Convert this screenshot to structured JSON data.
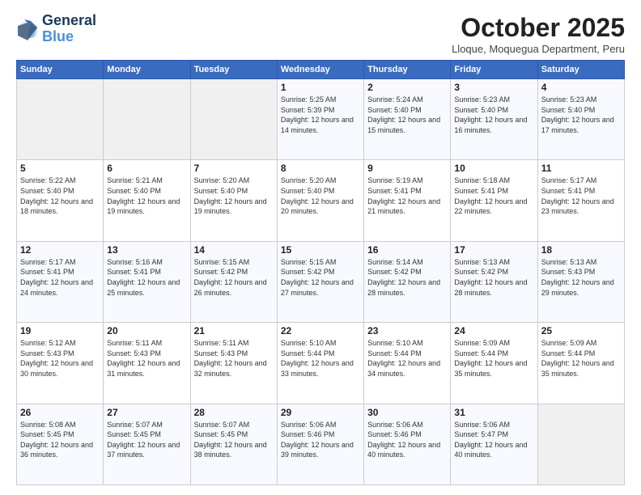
{
  "header": {
    "logo_line1": "General",
    "logo_line2": "Blue",
    "month_title": "October 2025",
    "location": "Lloque, Moquegua Department, Peru"
  },
  "weekdays": [
    "Sunday",
    "Monday",
    "Tuesday",
    "Wednesday",
    "Thursday",
    "Friday",
    "Saturday"
  ],
  "weeks": [
    [
      {
        "day": "",
        "sunrise": "",
        "sunset": "",
        "daylight": ""
      },
      {
        "day": "",
        "sunrise": "",
        "sunset": "",
        "daylight": ""
      },
      {
        "day": "",
        "sunrise": "",
        "sunset": "",
        "daylight": ""
      },
      {
        "day": "1",
        "sunrise": "Sunrise: 5:25 AM",
        "sunset": "Sunset: 5:39 PM",
        "daylight": "Daylight: 12 hours and 14 minutes."
      },
      {
        "day": "2",
        "sunrise": "Sunrise: 5:24 AM",
        "sunset": "Sunset: 5:40 PM",
        "daylight": "Daylight: 12 hours and 15 minutes."
      },
      {
        "day": "3",
        "sunrise": "Sunrise: 5:23 AM",
        "sunset": "Sunset: 5:40 PM",
        "daylight": "Daylight: 12 hours and 16 minutes."
      },
      {
        "day": "4",
        "sunrise": "Sunrise: 5:23 AM",
        "sunset": "Sunset: 5:40 PM",
        "daylight": "Daylight: 12 hours and 17 minutes."
      }
    ],
    [
      {
        "day": "5",
        "sunrise": "Sunrise: 5:22 AM",
        "sunset": "Sunset: 5:40 PM",
        "daylight": "Daylight: 12 hours and 18 minutes."
      },
      {
        "day": "6",
        "sunrise": "Sunrise: 5:21 AM",
        "sunset": "Sunset: 5:40 PM",
        "daylight": "Daylight: 12 hours and 19 minutes."
      },
      {
        "day": "7",
        "sunrise": "Sunrise: 5:20 AM",
        "sunset": "Sunset: 5:40 PM",
        "daylight": "Daylight: 12 hours and 19 minutes."
      },
      {
        "day": "8",
        "sunrise": "Sunrise: 5:20 AM",
        "sunset": "Sunset: 5:40 PM",
        "daylight": "Daylight: 12 hours and 20 minutes."
      },
      {
        "day": "9",
        "sunrise": "Sunrise: 5:19 AM",
        "sunset": "Sunset: 5:41 PM",
        "daylight": "Daylight: 12 hours and 21 minutes."
      },
      {
        "day": "10",
        "sunrise": "Sunrise: 5:18 AM",
        "sunset": "Sunset: 5:41 PM",
        "daylight": "Daylight: 12 hours and 22 minutes."
      },
      {
        "day": "11",
        "sunrise": "Sunrise: 5:17 AM",
        "sunset": "Sunset: 5:41 PM",
        "daylight": "Daylight: 12 hours and 23 minutes."
      }
    ],
    [
      {
        "day": "12",
        "sunrise": "Sunrise: 5:17 AM",
        "sunset": "Sunset: 5:41 PM",
        "daylight": "Daylight: 12 hours and 24 minutes."
      },
      {
        "day": "13",
        "sunrise": "Sunrise: 5:16 AM",
        "sunset": "Sunset: 5:41 PM",
        "daylight": "Daylight: 12 hours and 25 minutes."
      },
      {
        "day": "14",
        "sunrise": "Sunrise: 5:15 AM",
        "sunset": "Sunset: 5:42 PM",
        "daylight": "Daylight: 12 hours and 26 minutes."
      },
      {
        "day": "15",
        "sunrise": "Sunrise: 5:15 AM",
        "sunset": "Sunset: 5:42 PM",
        "daylight": "Daylight: 12 hours and 27 minutes."
      },
      {
        "day": "16",
        "sunrise": "Sunrise: 5:14 AM",
        "sunset": "Sunset: 5:42 PM",
        "daylight": "Daylight: 12 hours and 28 minutes."
      },
      {
        "day": "17",
        "sunrise": "Sunrise: 5:13 AM",
        "sunset": "Sunset: 5:42 PM",
        "daylight": "Daylight: 12 hours and 28 minutes."
      },
      {
        "day": "18",
        "sunrise": "Sunrise: 5:13 AM",
        "sunset": "Sunset: 5:43 PM",
        "daylight": "Daylight: 12 hours and 29 minutes."
      }
    ],
    [
      {
        "day": "19",
        "sunrise": "Sunrise: 5:12 AM",
        "sunset": "Sunset: 5:43 PM",
        "daylight": "Daylight: 12 hours and 30 minutes."
      },
      {
        "day": "20",
        "sunrise": "Sunrise: 5:11 AM",
        "sunset": "Sunset: 5:43 PM",
        "daylight": "Daylight: 12 hours and 31 minutes."
      },
      {
        "day": "21",
        "sunrise": "Sunrise: 5:11 AM",
        "sunset": "Sunset: 5:43 PM",
        "daylight": "Daylight: 12 hours and 32 minutes."
      },
      {
        "day": "22",
        "sunrise": "Sunrise: 5:10 AM",
        "sunset": "Sunset: 5:44 PM",
        "daylight": "Daylight: 12 hours and 33 minutes."
      },
      {
        "day": "23",
        "sunrise": "Sunrise: 5:10 AM",
        "sunset": "Sunset: 5:44 PM",
        "daylight": "Daylight: 12 hours and 34 minutes."
      },
      {
        "day": "24",
        "sunrise": "Sunrise: 5:09 AM",
        "sunset": "Sunset: 5:44 PM",
        "daylight": "Daylight: 12 hours and 35 minutes."
      },
      {
        "day": "25",
        "sunrise": "Sunrise: 5:09 AM",
        "sunset": "Sunset: 5:44 PM",
        "daylight": "Daylight: 12 hours and 35 minutes."
      }
    ],
    [
      {
        "day": "26",
        "sunrise": "Sunrise: 5:08 AM",
        "sunset": "Sunset: 5:45 PM",
        "daylight": "Daylight: 12 hours and 36 minutes."
      },
      {
        "day": "27",
        "sunrise": "Sunrise: 5:07 AM",
        "sunset": "Sunset: 5:45 PM",
        "daylight": "Daylight: 12 hours and 37 minutes."
      },
      {
        "day": "28",
        "sunrise": "Sunrise: 5:07 AM",
        "sunset": "Sunset: 5:45 PM",
        "daylight": "Daylight: 12 hours and 38 minutes."
      },
      {
        "day": "29",
        "sunrise": "Sunrise: 5:06 AM",
        "sunset": "Sunset: 5:46 PM",
        "daylight": "Daylight: 12 hours and 39 minutes."
      },
      {
        "day": "30",
        "sunrise": "Sunrise: 5:06 AM",
        "sunset": "Sunset: 5:46 PM",
        "daylight": "Daylight: 12 hours and 40 minutes."
      },
      {
        "day": "31",
        "sunrise": "Sunrise: 5:06 AM",
        "sunset": "Sunset: 5:47 PM",
        "daylight": "Daylight: 12 hours and 40 minutes."
      },
      {
        "day": "",
        "sunrise": "",
        "sunset": "",
        "daylight": ""
      }
    ]
  ]
}
